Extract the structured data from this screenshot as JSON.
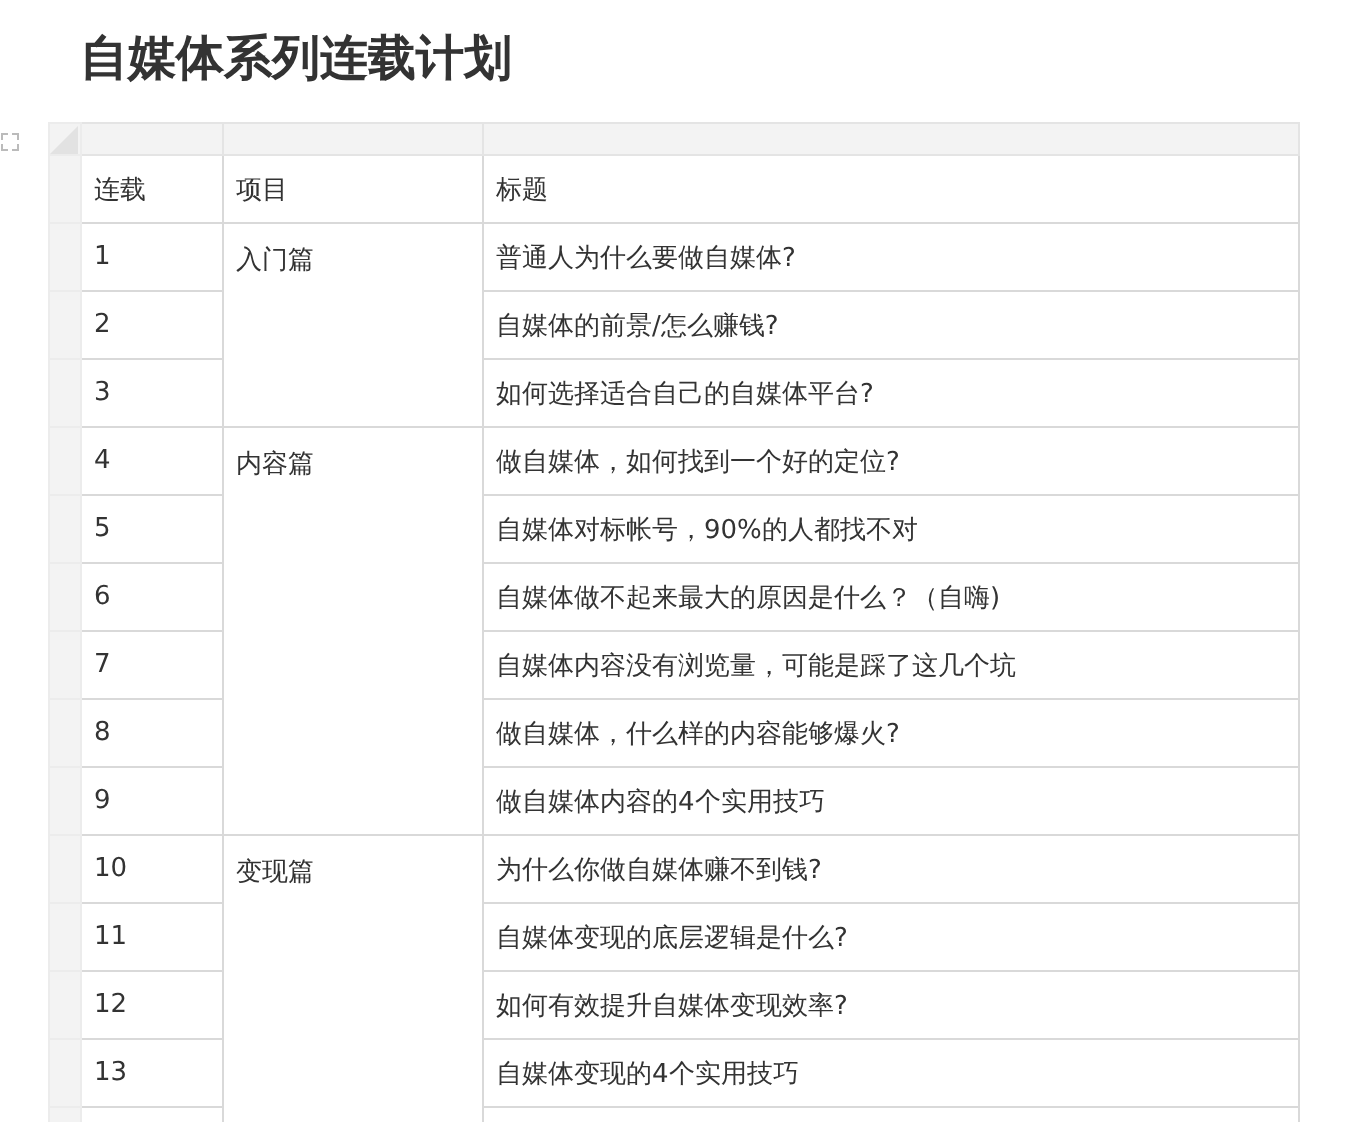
{
  "title": "自媒体系列连载计划",
  "columns": [
    "连载",
    "项目",
    "标题"
  ],
  "sections": [
    {
      "label": "入门篇",
      "rows": [
        {
          "num": "1",
          "title": "普通人为什么要做自媒体?"
        },
        {
          "num": "2",
          "title": "自媒体的前景/怎么赚钱?"
        },
        {
          "num": "3",
          "title": "如何选择适合自己的自媒体平台?"
        }
      ]
    },
    {
      "label": "内容篇",
      "rows": [
        {
          "num": "4",
          "title": "做自媒体，如何找到一个好的定位?"
        },
        {
          "num": "5",
          "title": "自媒体对标帐号，90%的人都找不对"
        },
        {
          "num": "6",
          "title": "自媒体做不起来最大的原因是什么？（自嗨)"
        },
        {
          "num": "7",
          "title": "自媒体内容没有浏览量，可能是踩了这几个坑"
        },
        {
          "num": "8",
          "title": "做自媒体，什么样的内容能够爆火?"
        },
        {
          "num": "9",
          "title": "做自媒体内容的4个实用技巧"
        }
      ]
    },
    {
      "label": "变现篇",
      "rows": [
        {
          "num": "10",
          "title": "为什么你做自媒体赚不到钱?"
        },
        {
          "num": "11",
          "title": "自媒体变现的底层逻辑是什么?"
        },
        {
          "num": "12",
          "title": "如何有效提升自媒体变现效率?"
        },
        {
          "num": "13",
          "title": "自媒体变现的4个实用技巧"
        }
      ]
    }
  ]
}
